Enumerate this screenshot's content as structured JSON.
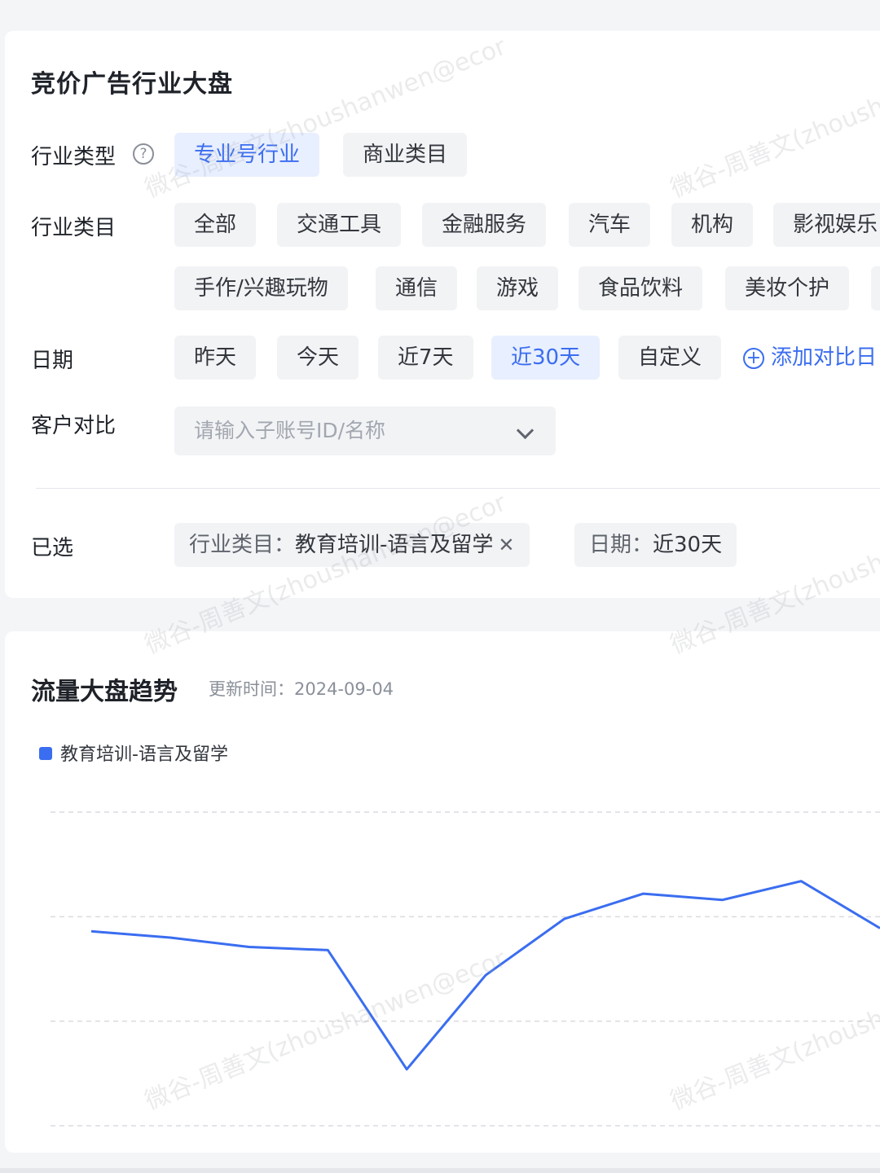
{
  "filters": {
    "title": "竞价广告行业大盘",
    "industry_type": {
      "label": "行业类型",
      "help_icon": "question-circle-icon",
      "options": [
        {
          "label": "专业号行业",
          "active": true
        },
        {
          "label": "商业类目",
          "active": false
        }
      ]
    },
    "industry_category": {
      "label": "行业类目",
      "row1": [
        "全部",
        "交通工具",
        "金融服务",
        "汽车",
        "机构",
        "影视娱乐"
      ],
      "row2": [
        "手作/兴趣玩物",
        "通信",
        "游戏",
        "食品饮料",
        "美妆个护"
      ]
    },
    "date": {
      "label": "日期",
      "options": [
        {
          "label": "昨天",
          "active": false
        },
        {
          "label": "今天",
          "active": false
        },
        {
          "label": "近7天",
          "active": false
        },
        {
          "label": "近30天",
          "active": true
        },
        {
          "label": "自定义",
          "active": false
        }
      ],
      "add_compare": "添加对比日"
    },
    "customer_compare": {
      "label": "客户对比",
      "placeholder": "请输入子账号ID/名称"
    },
    "selected": {
      "label": "已选",
      "tags": [
        {
          "key": "行业类目：",
          "value": "教育培训-语言及留学",
          "closable": true
        },
        {
          "key": "日期：",
          "value": "近30天",
          "closable": false
        }
      ]
    }
  },
  "trend": {
    "title": "流量大盘趋势",
    "updated_label": "更新时间：",
    "updated_value": "2024-09-04"
  },
  "watermark_text": "微谷-周善文(zhoushanwen@ecor",
  "colors": {
    "accent": "#3a6df0",
    "chip_bg": "#f2f3f5",
    "active_chip_bg": "#e8efff"
  },
  "chart_data": {
    "type": "line",
    "series": [
      {
        "name": "教育培训-语言及留学",
        "color": "#3a6df0",
        "values": [
          62,
          60,
          57,
          56,
          18,
          48,
          66,
          74,
          72,
          78,
          63
        ]
      }
    ],
    "ylim": [
      0,
      100
    ],
    "grid": true,
    "legend": "top-left"
  }
}
